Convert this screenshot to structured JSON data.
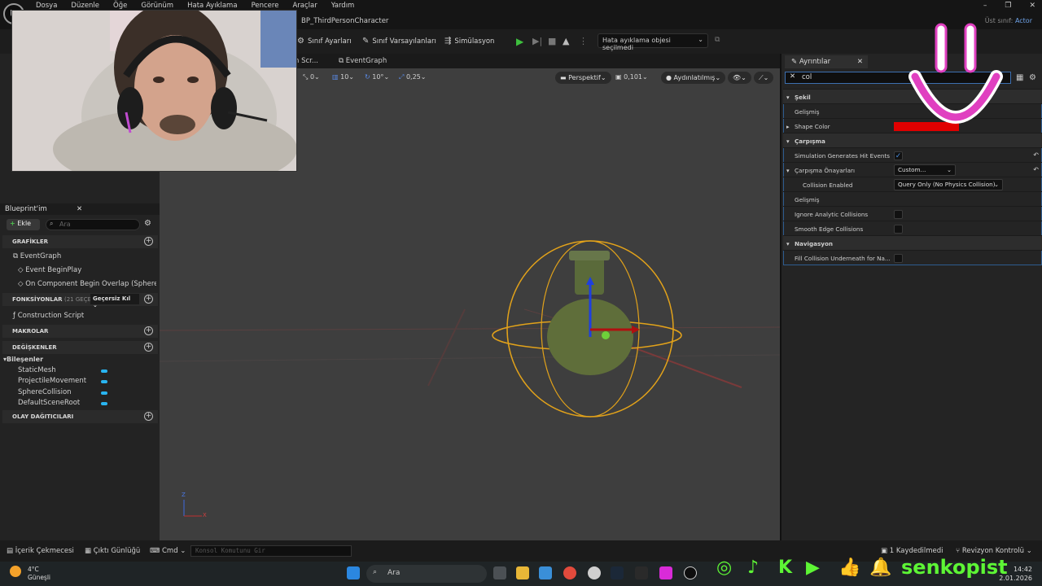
{
  "menu": [
    "Dosya",
    "Düzenle",
    "Öğe",
    "Görünüm",
    "Hata Ayıklama",
    "Pencere",
    "Araçlar",
    "Yardım"
  ],
  "logo_text": "U",
  "asset_tab": "BP_ThirdPersonCharacter",
  "parent_class": {
    "label": "Üst sınıf:",
    "value": "Actor"
  },
  "toolbar": {
    "class_settings": "Sınıf Ayarları",
    "class_defaults": "Sınıf Varsayılanları",
    "simulation": "Simülasyon",
    "debug_select": "Hata ayıklama objesi seçilmedi"
  },
  "graph_tabs": {
    "construction": "n Scr...",
    "event_graph": "EventGraph"
  },
  "viewport": {
    "rot_snap": "0",
    "grid": "10",
    "angle": "10°",
    "scale": "0,25",
    "perspective": "Perspektif",
    "camera_speed": "0,101",
    "lit_mode": "Aydınlatılmış",
    "axis_z": "Z",
    "axis_x": "X"
  },
  "blueprint": {
    "title": "Blueprint'im",
    "add_label": "Ekle",
    "search_placeholder": "Ara",
    "sections": {
      "graphs": "GRAFİKLER",
      "functions": "FONKSİYONLAR",
      "functions_count": "(21 GEÇERS",
      "override": "Geçersiz Kıl",
      "macros": "MAKROLAR",
      "variables": "DEĞİŞKENLER",
      "dispatchers": "OLAY DAĞITICILARI"
    },
    "graph_items": [
      "EventGraph",
      "Event BeginPlay",
      "On Component Begin Overlap (SphereCol"
    ],
    "function_items": [
      "Construction Script"
    ],
    "components_label": "Bileşenler",
    "components": [
      "StaticMesh",
      "ProjectileMovement",
      "SphereCollision",
      "DefaultSceneRoot"
    ]
  },
  "details": {
    "tab": "Ayrıntılar",
    "search_value": "col",
    "rows": {
      "shape": "Şekil",
      "advanced1": "Gelişmiş",
      "shape_color": "Shape Color",
      "collision": "Çarpışma",
      "sim_hit": "Simulation Generates Hit Events",
      "presets": "Çarpışma Önayarları",
      "presets_value": "Custom...",
      "enabled": "Collision Enabled",
      "enabled_value": "Query Only (No Physics Collision)",
      "advanced2": "Gelişmiş",
      "ignore_analytic": "Ignore Analytic Collisions",
      "smooth_edge": "Smooth Edge Collisions",
      "navigation": "Navigasyon",
      "fill_collision": "Fill Collision Underneath for Na..."
    },
    "shape_color_hex": "#e00000"
  },
  "statusbar": {
    "content_drawer": "İçerik Çekmecesi",
    "output_log": "Çıktı Günlüğü",
    "cmd": "Cmd",
    "console_placeholder": "Konsol Komutunu Gir",
    "saved": "1 Kaydedilmedi",
    "revision": "Revizyon Kontrolü"
  },
  "taskbar": {
    "temp": "4°C",
    "weather": "Güneşli",
    "search": "Ara",
    "time": "14:42",
    "date": "2.01.2026"
  },
  "brand": "senkopist",
  "colors": {
    "accent_green": "#5df535",
    "play_green": "#3ec03e",
    "highlight_pink": "#e040c0"
  }
}
